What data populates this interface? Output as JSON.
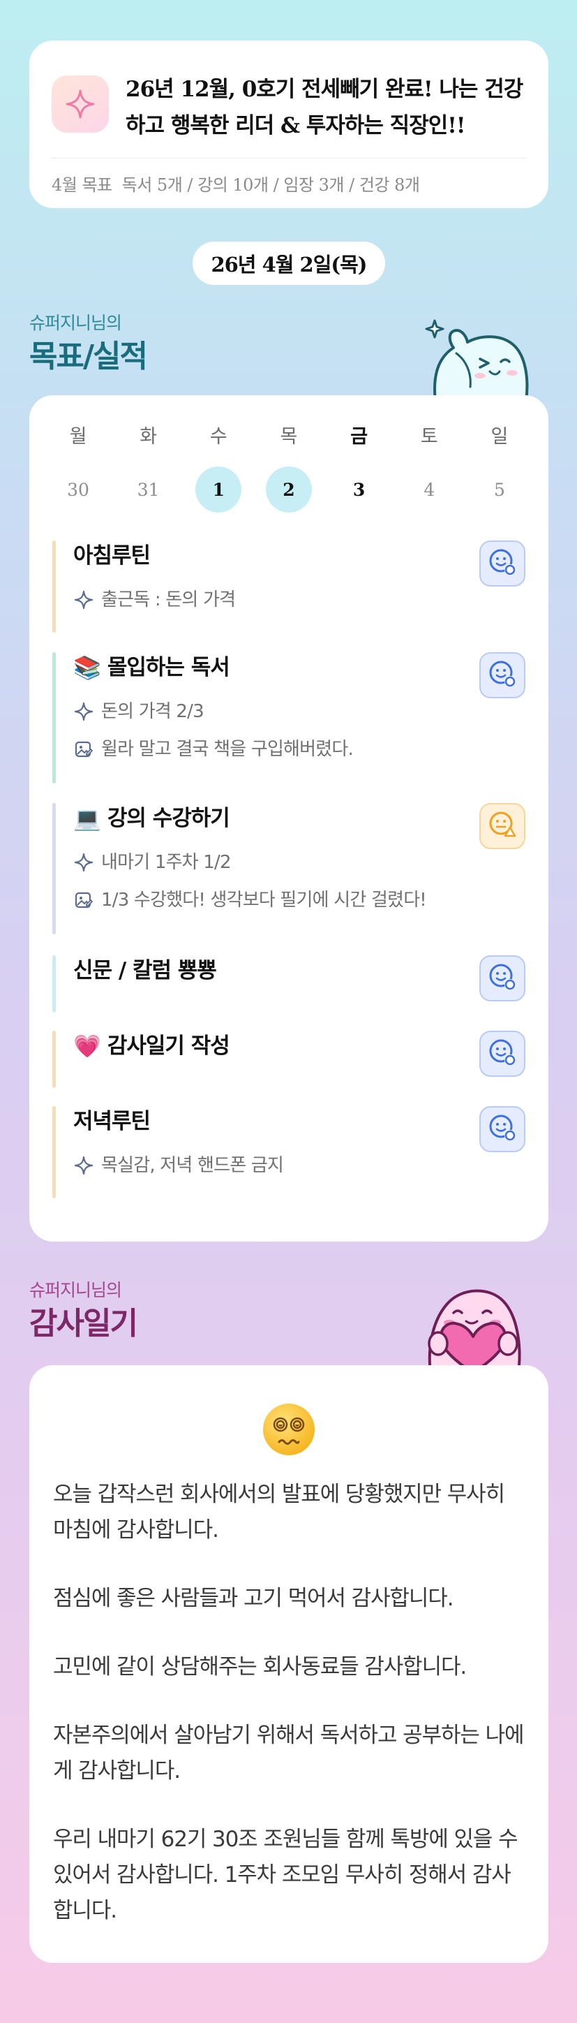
{
  "goal_card": {
    "icon": "sparkle-icon",
    "title": "26년 12월, 0호기 전세빼기 완료! 나는 건강하고 행복한 리더 & 투자하는 직장인!!",
    "month_label": "4월 목표",
    "month_targets": "독서 5개 / 강의 10개 / 임장 3개 / 건강 8개"
  },
  "date_pill": "26년 4월 2일(목)",
  "goals_section": {
    "owner": "슈퍼지니님의",
    "title": "목표/실적"
  },
  "week": [
    {
      "day": "월",
      "date": "30",
      "state": "past"
    },
    {
      "day": "화",
      "date": "31",
      "state": "past"
    },
    {
      "day": "수",
      "date": "1",
      "state": "done"
    },
    {
      "day": "목",
      "date": "2",
      "state": "done"
    },
    {
      "day": "금",
      "date": "3",
      "state": "today"
    },
    {
      "day": "토",
      "date": "4",
      "state": "future"
    },
    {
      "day": "일",
      "date": "5",
      "state": "future"
    }
  ],
  "goals": [
    {
      "emoji": "",
      "name": "아침루틴",
      "bar_color": "#fbdcb0",
      "status": "ok",
      "status_icon": "smile-check-icon",
      "subs": [
        {
          "icon": "sparkle-icon",
          "text": "출근독 : 돈의 가격"
        }
      ]
    },
    {
      "emoji": "📚",
      "name": "몰입하는 독서",
      "bar_color": "#b6ecd7",
      "status": "ok",
      "status_icon": "smile-check-icon",
      "subs": [
        {
          "icon": "sparkle-icon",
          "text": "돈의 가격 2/3"
        },
        {
          "icon": "memo-icon",
          "text": "윌라 말고 결국 책을 구입해버렸다."
        }
      ]
    },
    {
      "emoji": "💻",
      "name": "강의 수강하기",
      "bar_color": "#d3dcf3",
      "status": "warn",
      "status_icon": "smile-warning-icon",
      "subs": [
        {
          "icon": "sparkle-icon",
          "text": "내마기 1주차 1/2"
        },
        {
          "icon": "memo-icon",
          "text": "1/3 수강했다! 생각보다 필기에 시간 걸렸다!"
        }
      ]
    },
    {
      "emoji": "",
      "name": "신문 / 칼럼 뿅뿅",
      "bar_color": "#c6eef4",
      "status": "ok",
      "status_icon": "smile-check-icon",
      "subs": []
    },
    {
      "emoji": "💗",
      "name": "감사일기 작성",
      "bar_color": "#fbdcb0",
      "status": "ok",
      "status_icon": "smile-check-icon",
      "subs": []
    },
    {
      "emoji": "",
      "name": "저녁루틴",
      "bar_color": "#fbdcb0",
      "status": "ok",
      "status_icon": "smile-check-icon",
      "subs": [
        {
          "icon": "sparkle-icon",
          "text": "목실감, 저녁 핸드폰 금지"
        }
      ]
    }
  ],
  "diary_section": {
    "owner": "슈퍼지니님의",
    "title": "감사일기",
    "mood_emoji": "dizzy-face-icon",
    "paragraphs": [
      "오늘 갑작스런 회사에서의 발표에 당황했지만 무사히 마침에 감사합니다.",
      "점심에 좋은 사람들과 고기 먹어서 감사합니다.",
      "고민에 같이 상담해주는 회사동료들 감사합니다.",
      "자본주의에서 살아남기 위해서 독서하고 공부하는 나에게 감사합니다.",
      "우리 내마기 62기 30조 조원님들 함께 톡방에 있을 수 있어서 감사합니다. 1주차 조모임 무사히 정해서 감사합니다."
    ]
  }
}
